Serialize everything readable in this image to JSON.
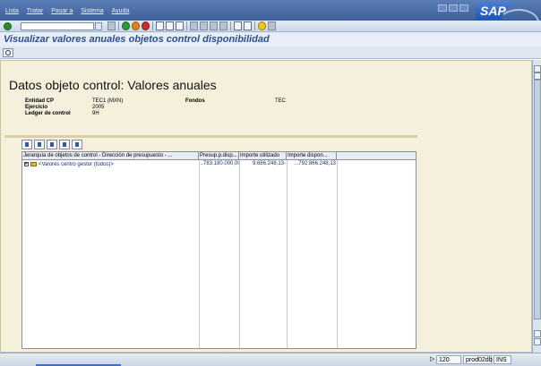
{
  "menu": {
    "items": [
      "Lista",
      "Tratar",
      "Pasar a",
      "Sistema",
      "Ayuda"
    ],
    "logo": "SAP"
  },
  "toolbar": {
    "command_value": "",
    "icons": [
      "enter-icon",
      "save-icon",
      "back-icon",
      "exit-icon",
      "cancel-icon",
      "print-icon",
      "find-icon",
      "find-next-icon",
      "first-page-icon",
      "prev-page-icon",
      "next-page-icon",
      "last-page-icon",
      "new-session-icon",
      "shortcut-icon",
      "help-icon",
      "layout-icon"
    ]
  },
  "title": "Visualizar valores anuales objetos control disponibilidad",
  "heading": "Datos objeto control: Valores anuales",
  "header_fields": {
    "entidad_label": "Entidad CP",
    "entidad_value": "TEC1 (MXN)",
    "fondos_label": "Fondos",
    "fondos_value": "TEC",
    "ejercicio_label": "Ejercicio",
    "ejercicio_value": "2005",
    "ledger_label": "Ledger de control",
    "ledger_value": "9H"
  },
  "grid": {
    "columns": [
      "Jerarquía de objetos de control - Dirección de presupuesto - ...",
      "Presup.p.disp...",
      "Importe utilizado",
      "Importe dispon..."
    ],
    "rows": [
      {
        "label": "<Valores centro gestor (todos)>",
        "presup": "...783.180.000,00",
        "utilizado": "9.686.248,13-",
        "disponible": "...792.866.248,13"
      }
    ]
  },
  "status": {
    "client": "120",
    "server": "prod02db",
    "mode": "INS"
  }
}
